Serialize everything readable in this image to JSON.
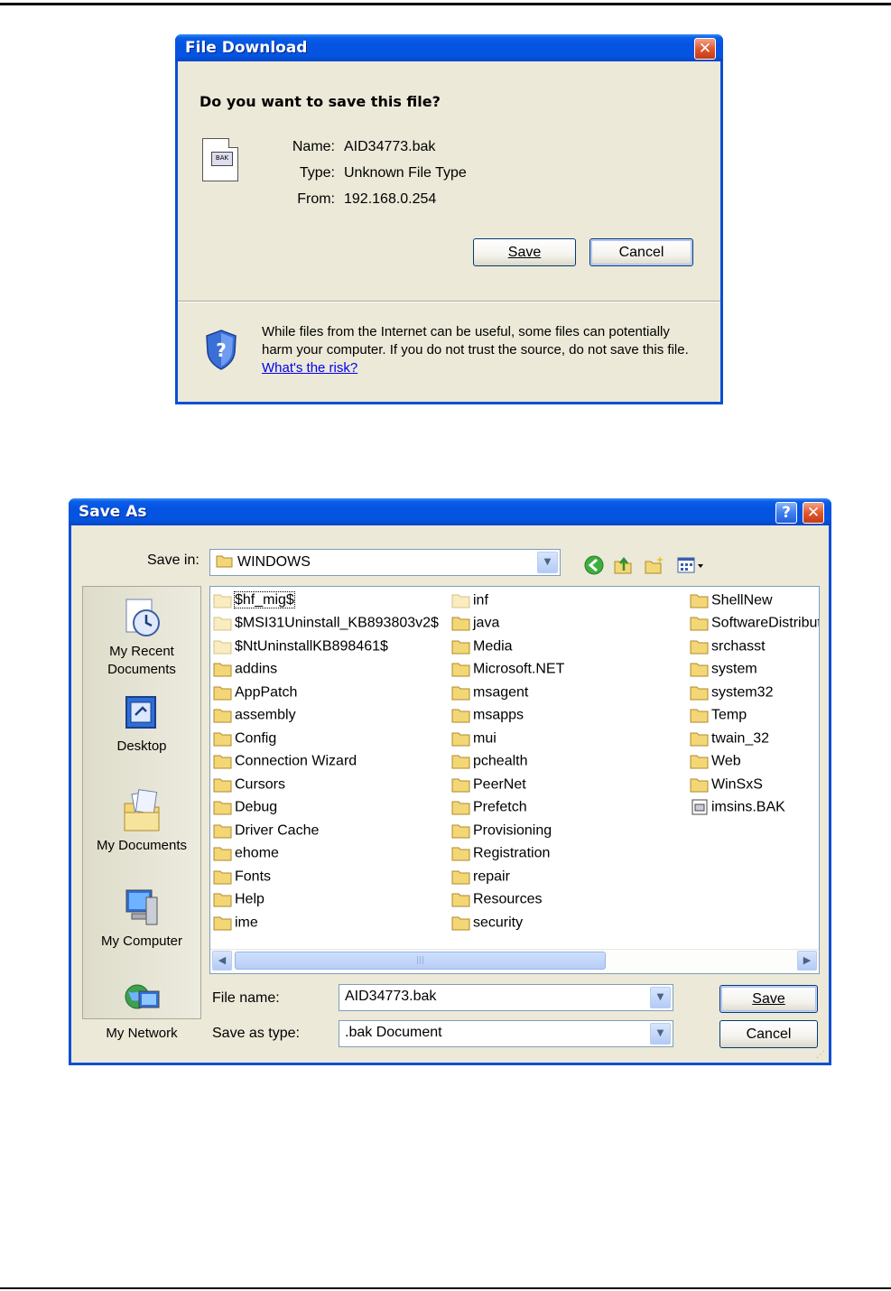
{
  "file_download": {
    "title": "File Download",
    "question": "Do you want to save this file?",
    "name_label": "Name:",
    "name_value": "AID34773.bak",
    "type_label": "Type:",
    "type_value": "Unknown File Type",
    "from_label": "From:",
    "from_value": "192.168.0.254",
    "save_button": "Save",
    "cancel_button": "Cancel",
    "close_glyph": "✕",
    "warning_text": "While files from the Internet can be useful, some files can potentially harm your computer. If you do not trust the source, do not save this file. ",
    "risk_link": "What's the risk?",
    "file_icon_text": "BAK"
  },
  "save_as": {
    "title": "Save As",
    "help_glyph": "?",
    "close_glyph": "✕",
    "save_in_label": "Save in:",
    "save_in_value": "WINDOWS",
    "toolbar_icons": [
      "back-icon",
      "up-folder-icon",
      "new-folder-icon",
      "view-menu-icon"
    ],
    "places": [
      {
        "label": "My Recent\nDocuments",
        "icon": "recent-documents-icon"
      },
      {
        "label": "Desktop",
        "icon": "desktop-icon"
      },
      {
        "label": "My Documents",
        "icon": "my-documents-icon"
      },
      {
        "label": "My Computer",
        "icon": "my-computer-icon"
      },
      {
        "label": "My Network",
        "icon": "my-network-icon"
      }
    ],
    "columns": [
      [
        "$hf_mig$",
        "$MSI31Uninstall_KB893803v2$",
        "$NtUninstallKB898461$",
        "addins",
        "AppPatch",
        "assembly",
        "Config",
        "Connection Wizard",
        "Cursors",
        "Debug",
        "Driver Cache",
        "ehome",
        "Fonts",
        "Help",
        "ime"
      ],
      [
        "inf",
        "java",
        "Media",
        "Microsoft.NET",
        "msagent",
        "msapps",
        "mui",
        "pchealth",
        "PeerNet",
        "Prefetch",
        "Provisioning",
        "Registration",
        "repair",
        "Resources",
        "security"
      ],
      [
        "ShellNew",
        "SoftwareDistribution",
        "srchasst",
        "system",
        "system32",
        "Temp",
        "twain_32",
        "Web",
        "WinSxS",
        "imsins.BAK"
      ]
    ],
    "file_name_label": "File name:",
    "file_name_value": "AID34773.bak",
    "save_type_label": "Save as type:",
    "save_type_value": ".bak Document",
    "save_button": "Save",
    "cancel_button": "Cancel"
  },
  "colors": {
    "titlebar": "#0553e1",
    "dialog_bg": "#ece9d8",
    "folder": "#f3d776",
    "link": "#0000ee"
  }
}
